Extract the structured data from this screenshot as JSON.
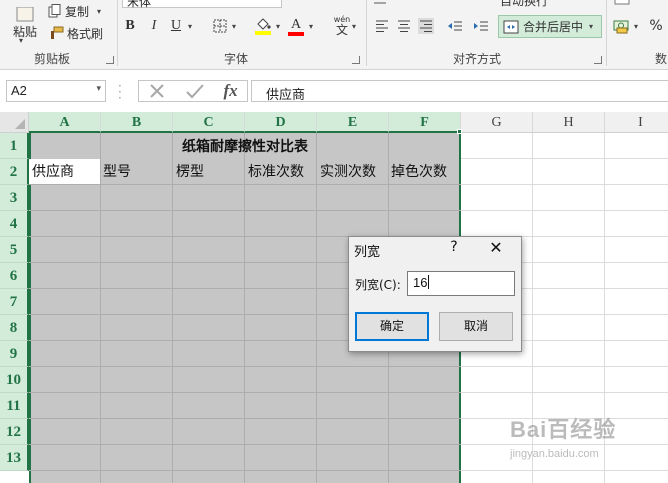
{
  "ribbon": {
    "clipboard": {
      "paste_label": "粘贴",
      "copy_label": "复制",
      "format_painter_label": "格式刷",
      "group_label": "剪贴板"
    },
    "font": {
      "font_name": "宋体",
      "bold": "B",
      "italic": "I",
      "underline": "U",
      "wen_label": "wén",
      "wen_char": "文",
      "font_color_letter": "A",
      "group_label": "字体"
    },
    "alignment": {
      "merge_center_label": "合并后居中",
      "wrap_label": "自动换行",
      "group_label": "对齐方式"
    },
    "number": {
      "percent": "%",
      "group_label": "数"
    },
    "colors": {
      "font_color_bar": "#ff0000",
      "fill_color_bar": "#ffff00",
      "merge_bg": "#d3ecd9"
    }
  },
  "formula_bar": {
    "name_box": "A2",
    "fx": "fx",
    "content": "供应商"
  },
  "grid": {
    "col_headers": [
      "A",
      "B",
      "C",
      "D",
      "E",
      "F",
      "G",
      "H",
      "I"
    ],
    "row_headers": [
      "1",
      "2",
      "3",
      "4",
      "5",
      "6",
      "7",
      "8",
      "9",
      "10",
      "11",
      "12",
      "13"
    ],
    "title": "纸箱耐摩擦性对比表",
    "header_row": [
      "供应商",
      "型号",
      "楞型",
      "标准次数",
      "实测次数",
      "掉色次数"
    ],
    "selection_color": "#217346"
  },
  "dialog": {
    "title": "列宽",
    "help": "?",
    "close": "✕",
    "label": "列宽(C):",
    "value": "16",
    "ok": "确定",
    "cancel": "取消"
  },
  "watermark": {
    "brand": "Bai百经验",
    "url": "jingyan.baidu.com"
  }
}
